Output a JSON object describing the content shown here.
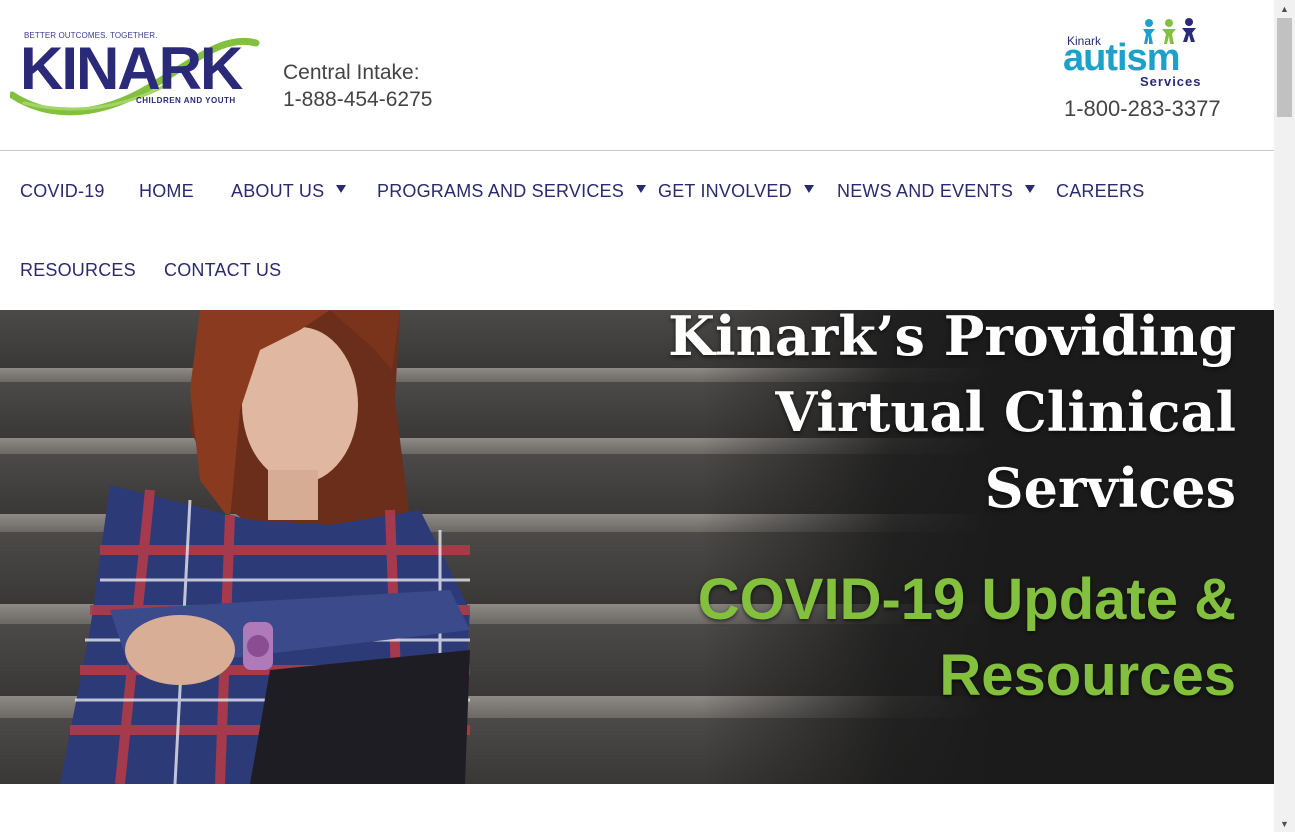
{
  "header": {
    "logo": {
      "tagline": "BETTER OUTCOMES. TOGETHER.",
      "wordmark": "KINARK",
      "subline": "CHILDREN AND YOUTH"
    },
    "central_intake_label": "Central Intake:",
    "central_intake_phone": "1-888-454-6275",
    "autism_logo": {
      "kinark": "Kinark",
      "autism": "autism",
      "services": "Services"
    },
    "autism_phone": "1-800-283-3377"
  },
  "nav": {
    "items": [
      {
        "label": "COVID-19",
        "has_dropdown": false
      },
      {
        "label": "HOME",
        "has_dropdown": false
      },
      {
        "label": "ABOUT US",
        "has_dropdown": true
      },
      {
        "label": "PROGRAMS AND SERVICES",
        "has_dropdown": true
      },
      {
        "label": "GET INVOLVED",
        "has_dropdown": true
      },
      {
        "label": "NEWS AND EVENTS",
        "has_dropdown": true
      },
      {
        "label": "CAREERS",
        "has_dropdown": false
      },
      {
        "label": "RESOURCES",
        "has_dropdown": false
      },
      {
        "label": "CONTACT US",
        "has_dropdown": false
      }
    ]
  },
  "hero": {
    "title_line1": "Kinark’s Providing",
    "title_line2": "Virtual Clinical",
    "title_line3": "Services",
    "cta_line1": "COVID-19 Update &",
    "cta_line2": "Resources"
  },
  "colors": {
    "brand_navy": "#2a2a78",
    "brand_green": "#83c03e",
    "autism_blue": "#1da1c9",
    "hero_bg": "#1b1b1b"
  },
  "icons": {
    "scroll_up": "triangle-up",
    "scroll_down": "triangle-down",
    "dropdown": "caret-down"
  }
}
